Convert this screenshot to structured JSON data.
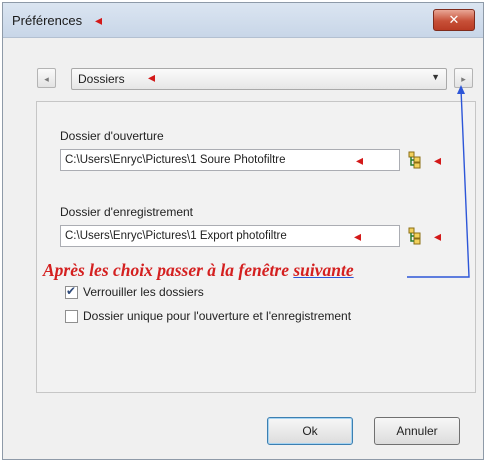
{
  "window": {
    "title": "Préférences",
    "close_label": "✕"
  },
  "nav": {
    "prev_label": "◂",
    "next_label": "▸",
    "category_selected": "Dossiers",
    "caret": "▼"
  },
  "fields": {
    "open_label": "Dossier d'ouverture",
    "open_value": "C:\\Users\\Enryc\\Pictures\\1 Soure Photofiltre",
    "save_label": "Dossier d'enregistrement",
    "save_value": "C:\\Users\\Enryc\\Pictures\\1 Export photofiltre"
  },
  "annotation": {
    "text_main": "Après les choix passer à la fenêtre ",
    "text_under": "suivante",
    "arrow": "◂",
    "color": "#d42020",
    "line_color": "#2d56d8"
  },
  "options": {
    "lock_label": "Verrouiller les dossiers",
    "lock_checked": true,
    "unique_label": "Dossier unique pour l'ouverture et l'enregistrement",
    "unique_checked": false,
    "tick": "✔"
  },
  "buttons": {
    "ok_label": "Ok",
    "cancel_label": "Annuler"
  }
}
